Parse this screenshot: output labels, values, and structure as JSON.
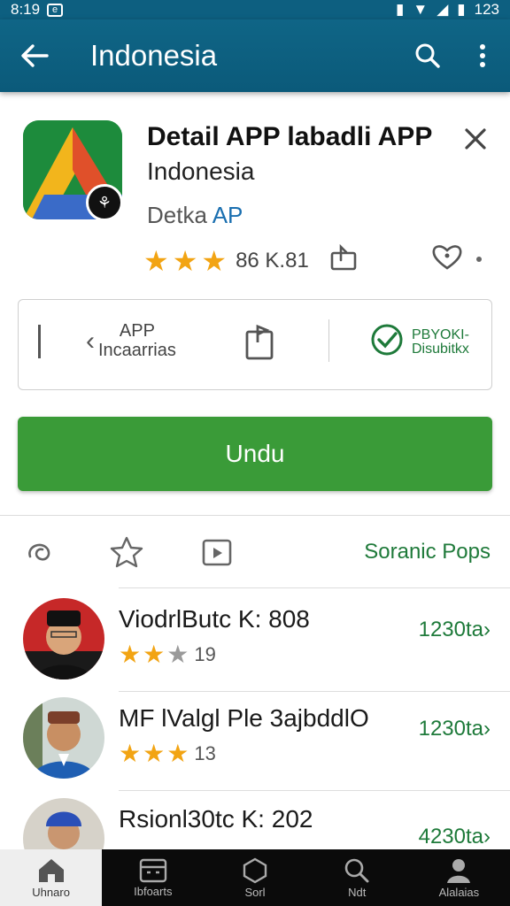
{
  "status_bar": {
    "time": "8:19",
    "battery": "123"
  },
  "app_bar": {
    "title": "Indonesia",
    "back_icon": "arrow-left-icon",
    "search_icon": "search-icon",
    "menu_icon": "more-vert-icon"
  },
  "app": {
    "title": "Detail APP labadli APP",
    "subtitle": "Indonesia",
    "developer_a": "Detka",
    "developer_b": "AP",
    "rating_text": "86 K.81",
    "stars": 3
  },
  "info_card": {
    "label_a_line1": "APP",
    "label_a_line2": "Incaarrias",
    "label_b_line1": "PBYOKI-",
    "label_b_line2": "Disubitkx"
  },
  "install": {
    "label": "Undu"
  },
  "tabs": {
    "more_label": "Soranic Pops"
  },
  "list": [
    {
      "name": "ViodrlButc K: 808",
      "stars_full": 2,
      "stars_half": 1,
      "count": "19",
      "price": "1230ta›"
    },
    {
      "name": "MF lValgl Ple 3ajbddlO",
      "stars_full": 3,
      "stars_half": 0,
      "count": "13",
      "price": "1230ta›"
    },
    {
      "name": "Rsionl30tc K: 202",
      "stars_full": 0,
      "stars_half": 0,
      "count": "",
      "price": "4230ta›"
    }
  ],
  "bottom_nav": [
    {
      "label": "Uhnaro",
      "icon": "home-icon",
      "active": true
    },
    {
      "label": "Ibfoarts",
      "icon": "apps-icon",
      "active": false
    },
    {
      "label": "Sorl",
      "icon": "hexagon-icon",
      "active": false
    },
    {
      "label": "Ndt",
      "icon": "search-icon",
      "active": false
    },
    {
      "label": "Alalaias",
      "icon": "person-icon",
      "active": false
    }
  ],
  "colors": {
    "app_bar": "#0f6586",
    "install": "#3a9b38",
    "accent_green": "#1e7a3a",
    "star": "#f2a413"
  }
}
